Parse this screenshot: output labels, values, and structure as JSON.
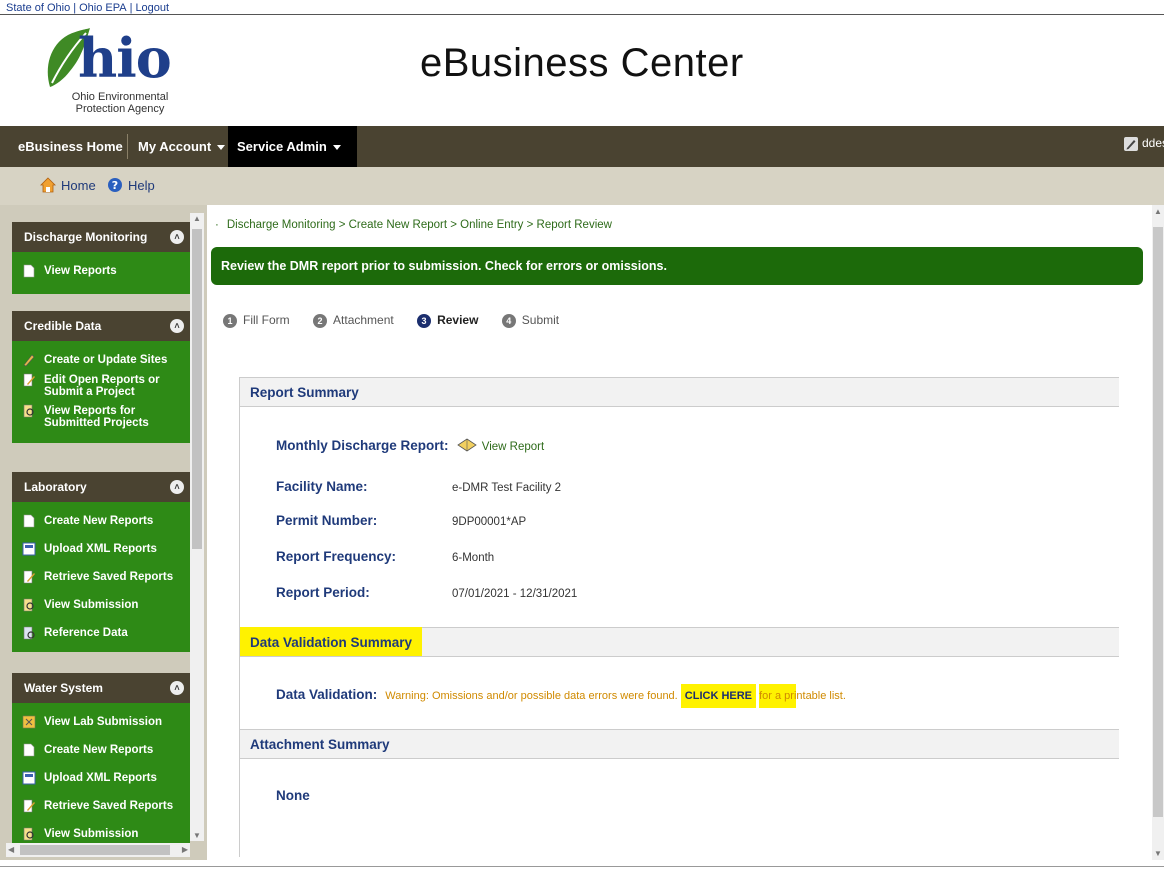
{
  "top_links": [
    "State of Ohio",
    "Ohio EPA",
    "Logout"
  ],
  "logo": {
    "brand": "hio",
    "agency_line1": "Ohio Environmental",
    "agency_line2": "Protection Agency"
  },
  "site_title": "eBusiness Center",
  "nav": {
    "home": "eBusiness Home",
    "account": "My Account",
    "service_admin": "Service Admin",
    "user": "ddessoir"
  },
  "subnav": {
    "home": "Home",
    "help": "Help"
  },
  "sidebar": {
    "panels": [
      {
        "title": "Discharge Monitoring",
        "items": [
          "View Reports"
        ]
      },
      {
        "title": "Credible Data",
        "items": [
          "Create or Update Sites",
          "Edit Open Reports or Submit a Project",
          "View Reports for Submitted Projects"
        ]
      },
      {
        "title": "Laboratory",
        "items": [
          "Create New Reports",
          "Upload XML Reports",
          "Retrieve Saved Reports",
          "View Submission",
          "Reference Data"
        ]
      },
      {
        "title": "Water System",
        "items": [
          "View Lab Submission",
          "Create New Reports",
          "Upload XML Reports",
          "Retrieve Saved Reports",
          "View Submission"
        ]
      }
    ]
  },
  "breadcrumb": "Discharge Monitoring > Create New Report > Online Entry > Report Review",
  "banner": "Review the DMR report prior to submission. Check for errors or omissions.",
  "steps": [
    {
      "num": "1",
      "label": "Fill Form"
    },
    {
      "num": "2",
      "label": "Attachment"
    },
    {
      "num": "3",
      "label": "Review"
    },
    {
      "num": "4",
      "label": "Submit"
    }
  ],
  "report_summary": {
    "heading": "Report Summary",
    "monthly_label": "Monthly Discharge Report:",
    "view_report": "View Report",
    "facility_label": "Facility Name:",
    "facility_value": "e-DMR Test Facility 2",
    "permit_label": "Permit Number:",
    "permit_value": "9DP00001*AP",
    "frequency_label": "Report Frequency:",
    "frequency_value": "6-Month",
    "period_label": "Report Period:",
    "period_value": "07/01/2021 - 12/31/2021"
  },
  "validation": {
    "heading": "Data Validation Summary",
    "label": "Data Validation:",
    "warning_pre": "Warning: Omissions and/or possible data errors were found.",
    "click_here": "CLICK HERE",
    "warning_mid": "for a pri",
    "warning_post": "ntable list."
  },
  "attachments": {
    "heading": "Attachment Summary",
    "value": "None"
  },
  "colors": {
    "nav_bg": "#4a4331",
    "sidebar_green": "#2e8a16",
    "banner_green": "#1c6a0a",
    "label_blue": "#1f3a7a",
    "highlight": "#fff200",
    "warning": "#d08a00"
  }
}
